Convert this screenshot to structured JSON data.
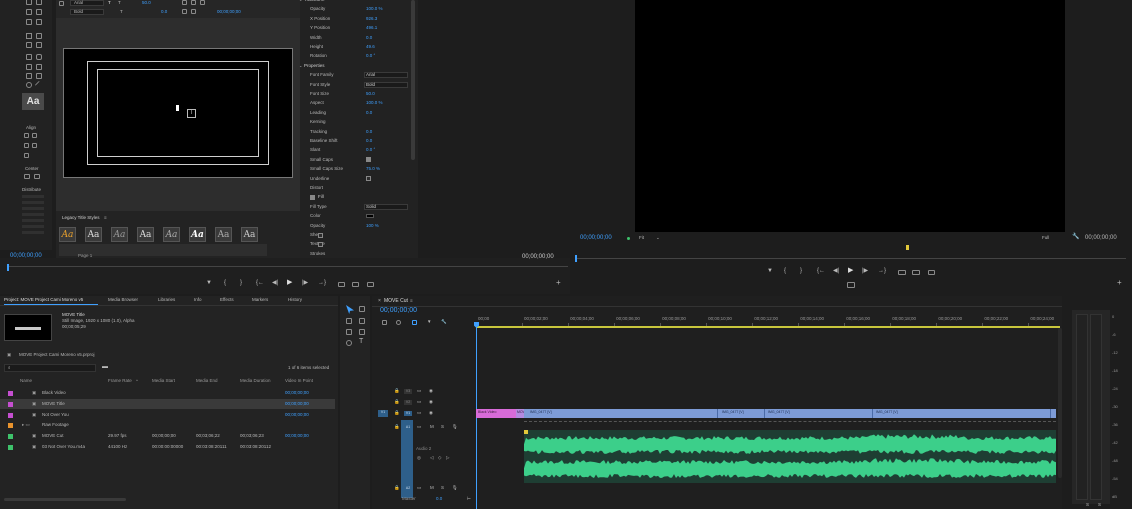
{
  "title_tools": {
    "font": "Arial",
    "style": "Bold",
    "size": "50.0",
    "kerning": "0.0",
    "timecode": "00;00;00;00"
  },
  "title_panel": {
    "align_label": "Align",
    "center_label": "Center",
    "distribute_label": "Distribute",
    "styles_label": "Legacy Title Styles",
    "page_label": "Page 1",
    "style_thumbs": [
      "Aa",
      "Aa",
      "Aa",
      "Aa",
      "Aa",
      "Aa",
      "Aa",
      "Aa",
      "Aa"
    ]
  },
  "title_properties": {
    "transform_label": "Transform",
    "props": [
      {
        "label": "Opacity",
        "value": "100.0 %"
      },
      {
        "label": "X Position",
        "value": "926.3"
      },
      {
        "label": "Y Position",
        "value": "496.1"
      },
      {
        "label": "Width",
        "value": "0.0"
      },
      {
        "label": "Height",
        "value": "49.6"
      },
      {
        "label": "Rotation",
        "value": "0.0 °"
      }
    ],
    "properties_label": "Properties",
    "props2": [
      {
        "label": "Font Family",
        "value": "Arial"
      },
      {
        "label": "Font Style",
        "value": "Bold"
      },
      {
        "label": "Font Size",
        "value": "50.0"
      },
      {
        "label": "Aspect",
        "value": "100.0 %"
      },
      {
        "label": "Leading",
        "value": "0.0"
      },
      {
        "label": "Kerning",
        "value": ""
      },
      {
        "label": "Tracking",
        "value": "0.0"
      },
      {
        "label": "Baseline Shift",
        "value": "0.0"
      },
      {
        "label": "Slant",
        "value": "0.0 °"
      },
      {
        "label": "Small Caps",
        "value": ""
      },
      {
        "label": "Small Caps Size",
        "value": "75.0 %"
      },
      {
        "label": "Underline",
        "value": ""
      },
      {
        "label": "Distort",
        "value": ""
      }
    ],
    "fill_label": "Fill",
    "fill_props": [
      {
        "label": "Fill Type",
        "value": "Solid"
      },
      {
        "label": "Color",
        "value": ""
      },
      {
        "label": "Opacity",
        "value": "100 %"
      },
      {
        "label": "Sheen",
        "value": ""
      },
      {
        "label": "Texture",
        "value": ""
      },
      {
        "label": "Strokes",
        "value": ""
      }
    ]
  },
  "source_monitor": {
    "timecode_left": "00;00;00;00",
    "timecode_right": "00;00;00;00"
  },
  "program_monitor": {
    "timecode": "00;00;00;00",
    "fit": "Fit",
    "full": "Full",
    "timecode_right": "00;00;00;00"
  },
  "project": {
    "tabs": [
      "Project: MOVE Project Cami Moreno v5",
      "Media Browser",
      "Libraries",
      "Info",
      "Effects",
      "Markers",
      "History"
    ],
    "clip_name": "MOVE Title",
    "clip_info1": "Still Image, 1920 x 1080 (1.0), Alpha",
    "clip_info2": "00;00;05;29",
    "project_file": "MOVE Project Cami Moreno v5.prproj",
    "items_selected": "1 of 6 items selected",
    "columns": [
      "Name",
      "Frame Rate",
      "Media Start",
      "Media End",
      "Media Duration",
      "Video In Point"
    ],
    "rows": [
      {
        "color": "#c54fd0",
        "name": "Black Video",
        "fps": "",
        "start": "",
        "end": "",
        "dur": "",
        "in": "00;00;00;00"
      },
      {
        "color": "#c54fd0",
        "name": "MOVE Title",
        "fps": "",
        "start": "",
        "end": "",
        "dur": "",
        "in": "00;00;00;00"
      },
      {
        "color": "#c54fd0",
        "name": "Not Over You",
        "fps": "",
        "start": "",
        "end": "",
        "dur": "",
        "in": "00;00;00;00"
      },
      {
        "color": "#e8932d",
        "name": "Raw Footage",
        "fps": "",
        "start": "",
        "end": "",
        "dur": "",
        "in": ""
      },
      {
        "color": "#3ec26b",
        "name": "MOVE Cut",
        "fps": "29.97 fps",
        "start": "00;00;00;00",
        "end": "00;03;06;22",
        "dur": "00;03;06;23",
        "in": "00;00;00;00"
      },
      {
        "color": "#3ec26b",
        "name": "03 Not Over You.m4a",
        "fps": "44100 Hz",
        "start": "00:00:00:00000",
        "end": "00:03:08:20111",
        "dur": "00:03:08:20112",
        "in": ""
      }
    ]
  },
  "timeline": {
    "tab": "MOVE Cut",
    "timecode": "00;00;00;00",
    "ruler": [
      "00;00",
      "00;00;02;00",
      "00;00;04;00",
      "00;00;06;00",
      "00;00;08;00",
      "00;00;10;00",
      "00;00;12;00",
      "00;00;14;00",
      "00;00;16;00",
      "00;00;18;00",
      "00;00;20;00",
      "00;00;22;00",
      "00;00;24;00"
    ],
    "track_labels": [
      "V3",
      "V2",
      "V1",
      "A1",
      "A2"
    ],
    "clip_black": "Black Video",
    "clip_title": "MOVE",
    "clip_segments": [
      "IMG_0477 [V]",
      "IMG_0477 [V]",
      "IMG_0477 [V]",
      "IMG_0477 [V]"
    ],
    "audio_label": "Audio 2",
    "master_label": "Master",
    "master_value": "0.0"
  },
  "meter_labels": [
    "0",
    "-6",
    "-12",
    "-18",
    "-24",
    "-30",
    "-36",
    "-42",
    "-48",
    "-54",
    "dB"
  ],
  "colors": {
    "accent": "#3fa0ff",
    "video_clip": "#7d9bd6",
    "black_clip": "#d86bd8",
    "audio": "#3ccf8a"
  }
}
